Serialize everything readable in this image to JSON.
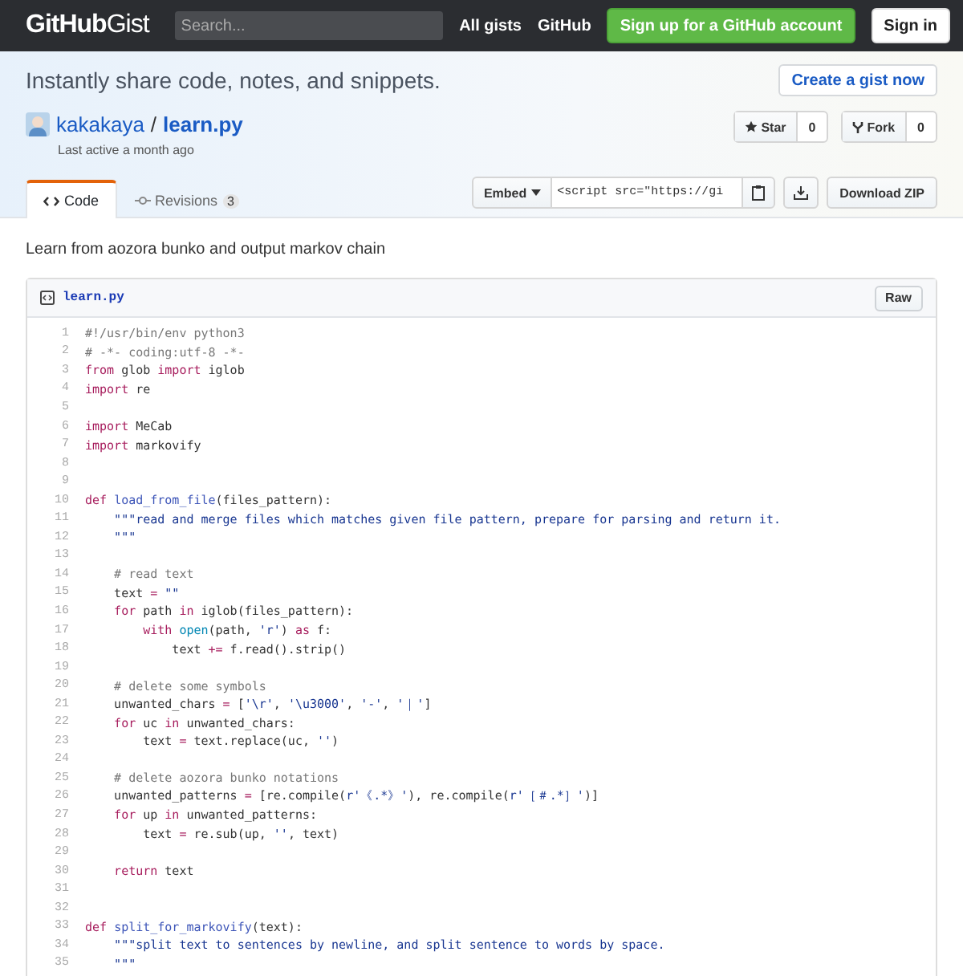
{
  "header": {
    "brand": "GitHub",
    "product": "Gist",
    "search": {
      "placeholder": "Search..."
    },
    "nav": [
      "All gists",
      "GitHub"
    ],
    "signup": "Sign up for a GitHub account",
    "signin": "Sign in"
  },
  "banner": {
    "tagline": "Instantly share code, notes, and snippets.",
    "create": "Create a gist now"
  },
  "gist": {
    "owner": "kakakaya",
    "separator": "/",
    "name": "learn.py",
    "updated": "Last active a month ago",
    "actions": [
      {
        "label": "Star",
        "count": "0"
      },
      {
        "label": "Fork",
        "count": "0"
      }
    ]
  },
  "tabs": [
    {
      "label": "Code",
      "selected": true
    },
    {
      "label": "Revisions",
      "count": "3",
      "selected": false
    }
  ],
  "embed": {
    "label": "Embed",
    "value": "<script src=\"https://gi",
    "download": "Download ZIP"
  },
  "description": "Learn from aozora bunko and output markov chain",
  "file": {
    "name": "learn.py",
    "raw": "Raw",
    "lines": [
      {
        "number": "1",
        "tokens": [
          {
            "kind": "comment",
            "text": "#!/usr/bin/env python3"
          }
        ]
      },
      {
        "number": "2",
        "tokens": [
          {
            "kind": "comment",
            "text": "# -*- coding:utf-8 -*-"
          }
        ]
      },
      {
        "number": "3",
        "tokens": [
          {
            "kind": "keyword",
            "text": "from"
          },
          {
            "kind": "plain",
            "text": " glob "
          },
          {
            "kind": "keyword",
            "text": "import"
          },
          {
            "kind": "plain",
            "text": " iglob"
          }
        ]
      },
      {
        "number": "4",
        "tokens": [
          {
            "kind": "keyword",
            "text": "import"
          },
          {
            "kind": "plain",
            "text": " re"
          }
        ]
      },
      {
        "number": "5"
      },
      {
        "number": "6",
        "tokens": [
          {
            "kind": "keyword",
            "text": "import"
          },
          {
            "kind": "plain",
            "text": " MeCab"
          }
        ]
      },
      {
        "number": "7",
        "tokens": [
          {
            "kind": "keyword",
            "text": "import"
          },
          {
            "kind": "plain",
            "text": " markovify"
          }
        ]
      },
      {
        "number": "8"
      },
      {
        "number": "9"
      },
      {
        "number": "10",
        "tokens": [
          {
            "kind": "keyword",
            "text": "def "
          },
          {
            "kind": "function",
            "text": "load_from_file"
          },
          {
            "kind": "plain",
            "text": "(files_pattern):"
          }
        ]
      },
      {
        "number": "11",
        "tokens": [
          {
            "kind": "string",
            "text": "    \"\"\"read and merge files which matches given file pattern, prepare for parsing and return it."
          }
        ]
      },
      {
        "number": "12",
        "tokens": [
          {
            "kind": "string",
            "text": "    \"\"\""
          }
        ]
      },
      {
        "number": "13"
      },
      {
        "number": "14",
        "tokens": [
          {
            "kind": "comment",
            "text": "    # read text"
          }
        ]
      },
      {
        "number": "15",
        "tokens": [
          {
            "kind": "plain",
            "text": "    text "
          },
          {
            "kind": "keyword",
            "text": "= "
          },
          {
            "kind": "string",
            "text": "\"\""
          }
        ]
      },
      {
        "number": "16",
        "tokens": [
          {
            "kind": "keyword",
            "text": "    for"
          },
          {
            "kind": "plain",
            "text": " path "
          },
          {
            "kind": "keyword",
            "text": "in"
          },
          {
            "kind": "plain",
            "text": " iglob(files_pattern):"
          }
        ]
      },
      {
        "number": "17",
        "tokens": [
          {
            "kind": "keyword",
            "text": "        with "
          },
          {
            "kind": "builtin",
            "text": "open"
          },
          {
            "kind": "plain",
            "text": "(path, "
          },
          {
            "kind": "string",
            "text": "'r'"
          },
          {
            "kind": "plain",
            "text": ") "
          },
          {
            "kind": "keyword",
            "text": "as"
          },
          {
            "kind": "plain",
            "text": " f:"
          }
        ]
      },
      {
        "number": "18",
        "tokens": [
          {
            "kind": "plain",
            "text": "            text "
          },
          {
            "kind": "keyword",
            "text": "+="
          },
          {
            "kind": "plain",
            "text": " f.read().strip()"
          }
        ]
      },
      {
        "number": "19"
      },
      {
        "number": "20",
        "tokens": [
          {
            "kind": "comment",
            "text": "    # delete some symbols"
          }
        ]
      },
      {
        "number": "21",
        "tokens": [
          {
            "kind": "plain",
            "text": "    unwanted_chars "
          },
          {
            "kind": "keyword",
            "text": "="
          },
          {
            "kind": "plain",
            "text": " ["
          },
          {
            "kind": "string",
            "text": "'\\r'"
          },
          {
            "kind": "plain",
            "text": ", "
          },
          {
            "kind": "string",
            "text": "'\\u3000'"
          },
          {
            "kind": "plain",
            "text": ", "
          },
          {
            "kind": "string",
            "text": "'-'"
          },
          {
            "kind": "plain",
            "text": ", "
          },
          {
            "kind": "string",
            "text": "'｜'"
          },
          {
            "kind": "plain",
            "text": "]"
          }
        ]
      },
      {
        "number": "22",
        "tokens": [
          {
            "kind": "keyword",
            "text": "    for"
          },
          {
            "kind": "plain",
            "text": " uc "
          },
          {
            "kind": "keyword",
            "text": "in"
          },
          {
            "kind": "plain",
            "text": " unwanted_chars:"
          }
        ]
      },
      {
        "number": "23",
        "tokens": [
          {
            "kind": "plain",
            "text": "        text "
          },
          {
            "kind": "keyword",
            "text": "="
          },
          {
            "kind": "plain",
            "text": " text.replace(uc, "
          },
          {
            "kind": "string",
            "text": "''"
          },
          {
            "kind": "plain",
            "text": ")"
          }
        ]
      },
      {
        "number": "24"
      },
      {
        "number": "25",
        "tokens": [
          {
            "kind": "comment",
            "text": "    # delete aozora bunko notations"
          }
        ]
      },
      {
        "number": "26",
        "tokens": [
          {
            "kind": "plain",
            "text": "    unwanted_patterns "
          },
          {
            "kind": "keyword",
            "text": "="
          },
          {
            "kind": "plain",
            "text": " [re.compile("
          },
          {
            "kind": "string",
            "text": "r'《.*》'"
          },
          {
            "kind": "plain",
            "text": "), re.compile("
          },
          {
            "kind": "string",
            "text": "r'［＃.*］'"
          },
          {
            "kind": "plain",
            "text": ")]"
          }
        ]
      },
      {
        "number": "27",
        "tokens": [
          {
            "kind": "keyword",
            "text": "    for"
          },
          {
            "kind": "plain",
            "text": " up "
          },
          {
            "kind": "keyword",
            "text": "in"
          },
          {
            "kind": "plain",
            "text": " unwanted_patterns:"
          }
        ]
      },
      {
        "number": "28",
        "tokens": [
          {
            "kind": "plain",
            "text": "        text "
          },
          {
            "kind": "keyword",
            "text": "="
          },
          {
            "kind": "plain",
            "text": " re.sub(up, "
          },
          {
            "kind": "string",
            "text": "''"
          },
          {
            "kind": "plain",
            "text": ", text)"
          }
        ]
      },
      {
        "number": "29"
      },
      {
        "number": "30",
        "tokens": [
          {
            "kind": "keyword",
            "text": "    return"
          },
          {
            "kind": "plain",
            "text": " text"
          }
        ]
      },
      {
        "number": "31"
      },
      {
        "number": "32"
      },
      {
        "number": "33",
        "tokens": [
          {
            "kind": "keyword",
            "text": "def "
          },
          {
            "kind": "function",
            "text": "split_for_markovify"
          },
          {
            "kind": "plain",
            "text": "(text):"
          }
        ]
      },
      {
        "number": "34",
        "tokens": [
          {
            "kind": "string",
            "text": "    \"\"\"split text to sentences by newline, and split sentence to words by space."
          }
        ]
      },
      {
        "number": "35",
        "tokens": [
          {
            "kind": "string",
            "text": "    \"\"\""
          }
        ]
      }
    ]
  }
}
